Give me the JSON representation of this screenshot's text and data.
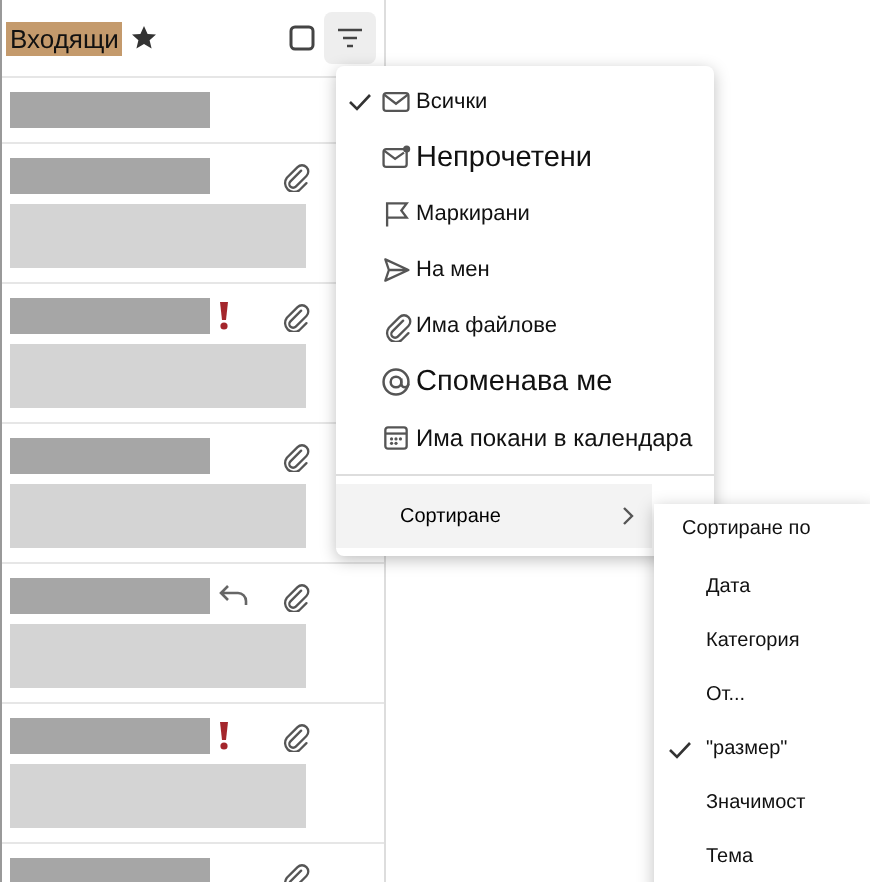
{
  "header": {
    "title": "Входящи"
  },
  "messages": [
    {
      "preview": false,
      "important": false,
      "replied": false,
      "attachment": false
    },
    {
      "preview": true,
      "important": false,
      "replied": false,
      "attachment": true
    },
    {
      "preview": true,
      "important": true,
      "replied": false,
      "attachment": true
    },
    {
      "preview": true,
      "important": false,
      "replied": false,
      "attachment": true
    },
    {
      "preview": true,
      "important": false,
      "replied": true,
      "attachment": true
    },
    {
      "preview": true,
      "important": true,
      "replied": false,
      "attachment": true
    },
    {
      "preview": false,
      "important": false,
      "replied": false,
      "attachment": true
    }
  ],
  "filter_menu": {
    "items": [
      {
        "label": "Всички",
        "kind": "mail",
        "selected": true
      },
      {
        "label": "Непрочетени",
        "kind": "unread",
        "selected": false
      },
      {
        "label": "Маркирани",
        "kind": "flag",
        "selected": false
      },
      {
        "label": "На мен",
        "kind": "send",
        "selected": false
      },
      {
        "label": "Има файлове",
        "kind": "attach",
        "selected": false
      },
      {
        "label": "Споменава ме",
        "kind": "mention",
        "selected": false
      },
      {
        "label": "Има покани в календара",
        "kind": "calendar",
        "selected": false
      }
    ],
    "sort": {
      "label": "Сортиране",
      "expanded": true
    }
  },
  "sort_menu": {
    "title": "Сортиране по",
    "items": [
      {
        "label": "Дата",
        "selected": false
      },
      {
        "label": "Категория",
        "selected": false
      },
      {
        "label": "От...",
        "selected": false
      },
      {
        "label": "\"размер\"",
        "selected": true
      },
      {
        "label": "Значимост",
        "selected": false
      },
      {
        "label": "Тема",
        "selected": false
      }
    ]
  }
}
